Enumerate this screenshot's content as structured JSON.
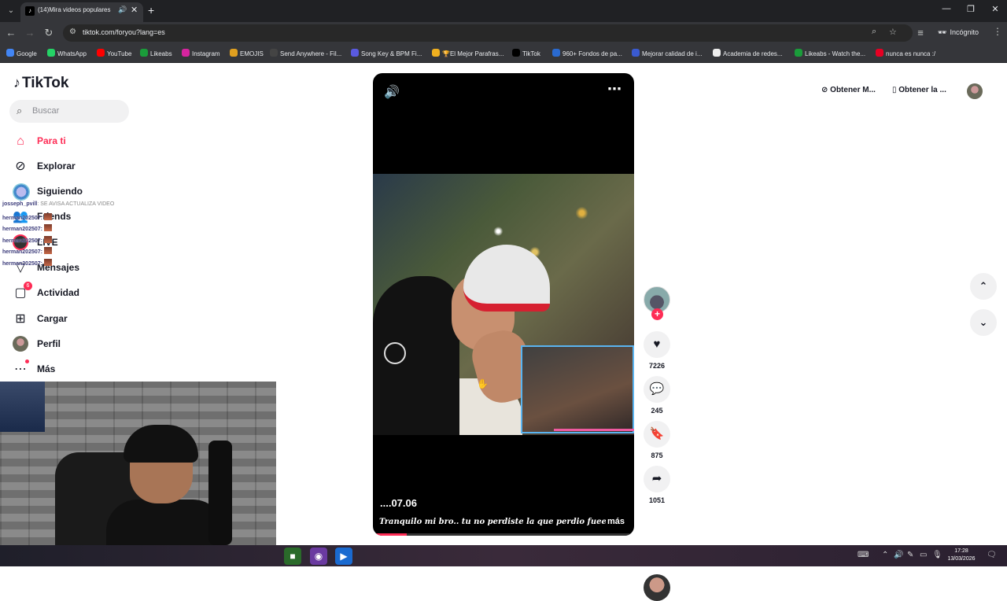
{
  "browser": {
    "tab_title": "(14)Mira videos populares",
    "url": "tiktok.com/foryou?lang=es",
    "incognito_label": "Incógnito",
    "bookmarks": [
      {
        "label": "Google",
        "color": "#4285f4"
      },
      {
        "label": "WhatsApp",
        "color": "#25d366"
      },
      {
        "label": "YouTube",
        "color": "#ff0000"
      },
      {
        "label": "Likeabs",
        "color": "#1a9c3a"
      },
      {
        "label": "Instagram",
        "color": "#d6249f"
      },
      {
        "label": "EMOJIS",
        "color": "#e0a020"
      },
      {
        "label": "Send Anywhere - Fil...",
        "color": "#444"
      },
      {
        "label": "Song Key & BPM Fi...",
        "color": "#5a5ae0"
      },
      {
        "label": "🏆El Mejor Parafras...",
        "color": "#f0b020"
      },
      {
        "label": "TikTok",
        "color": "#000"
      },
      {
        "label": "960+ Fondos de pa...",
        "color": "#2a6ad0"
      },
      {
        "label": "Mejorar calidad de i...",
        "color": "#3a5ad0"
      },
      {
        "label": "Academia de redes...",
        "color": "#eee"
      },
      {
        "label": "Likeabs - Watch the...",
        "color": "#1a9c3a"
      },
      {
        "label": "nunca es nunca :/",
        "color": "#e60023"
      }
    ]
  },
  "tiktok": {
    "logo": "TikTok",
    "search_placeholder": "Buscar",
    "nav": [
      {
        "label": "Para ti",
        "icon": "home-icon"
      },
      {
        "label": "Explorar",
        "icon": "compass-icon"
      },
      {
        "label": "Siguiendo",
        "icon": "following-avatar"
      },
      {
        "label": "Friends",
        "icon": "friends-icon"
      },
      {
        "label": "LIVE",
        "icon": "live-avatar"
      },
      {
        "label": "Mensajes",
        "icon": "send-icon"
      },
      {
        "label": "Actividad",
        "icon": "activity-icon",
        "badge": "6"
      },
      {
        "label": "Cargar",
        "icon": "upload-icon"
      },
      {
        "label": "Perfil",
        "icon": "profile-avatar"
      },
      {
        "label": "Más",
        "icon": "more-icon"
      }
    ],
    "chat": [
      {
        "user": "josseph_pvill",
        "text": ": SE AVISA ACTUALIZA VIDEO"
      },
      {
        "user": "herman202507",
        "text": ":"
      },
      {
        "user": "herman202507",
        "text": ":"
      },
      {
        "user": "herman202507",
        "text": ":"
      },
      {
        "user": "herman202507",
        "text": ":"
      },
      {
        "user": "herman202507",
        "text": ":"
      }
    ],
    "video": {
      "author": "....07.06",
      "caption": "Tranquilo mi bro.. tu no perdiste la que perdio fuee ella...tu",
      "more_label": "más",
      "progress": 0.13
    },
    "actions": {
      "likes": "7226",
      "comments": "245",
      "saves": "875",
      "shares": "1051"
    },
    "top_right": {
      "get_coins": "Obtener M...",
      "get_app": "Obtener la ..."
    }
  },
  "taskbar": {
    "time": "17:28",
    "date": "13/03/2026"
  },
  "colors": {
    "accent": "#fe2c55",
    "text": "#161823"
  }
}
